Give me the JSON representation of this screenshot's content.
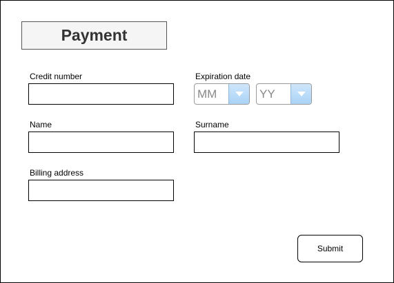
{
  "form": {
    "title": "Payment",
    "credit_number": {
      "label": "Credit number",
      "value": ""
    },
    "expiration": {
      "label": "Expiration date",
      "month": {
        "selected": "MM",
        "icon": "chevron-down-icon"
      },
      "year": {
        "selected": "YY",
        "icon": "chevron-down-icon"
      }
    },
    "name": {
      "label": "Name",
      "value": ""
    },
    "surname": {
      "label": "Surname",
      "value": ""
    },
    "billing_address": {
      "label": "Billing address",
      "value": ""
    },
    "submit_label": "Submit"
  },
  "colors": {
    "border": "#000000",
    "title_background": "#f5f5f5",
    "dropdown_arrow_bg": "#a9d3f6",
    "dropdown_arrow": "#ffffff"
  }
}
